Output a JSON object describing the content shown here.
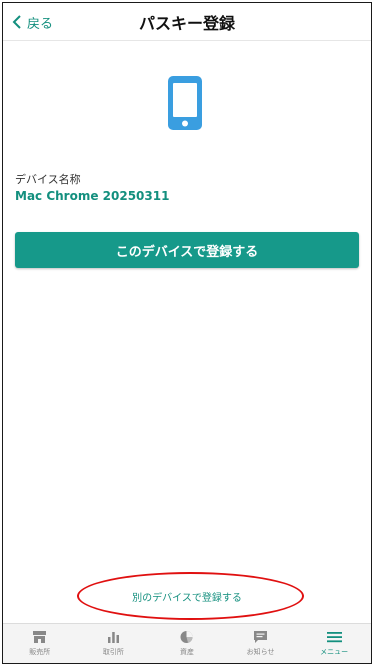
{
  "header": {
    "back_label": "戻る",
    "title": "パスキー登録"
  },
  "device": {
    "label": "デバイス名称",
    "name": "Mac Chrome 20250311"
  },
  "actions": {
    "register_this_device": "このデバイスで登録する",
    "register_other_device": "別のデバイスで登録する"
  },
  "tabbar": {
    "items": [
      {
        "label": "販売所",
        "icon": "shop-icon"
      },
      {
        "label": "取引所",
        "icon": "bar-chart-icon"
      },
      {
        "label": "資産",
        "icon": "pie-chart-icon"
      },
      {
        "label": "お知らせ",
        "icon": "message-icon"
      },
      {
        "label": "メニュー",
        "icon": "menu-icon",
        "active": true
      }
    ]
  },
  "colors": {
    "accent": "#16998a",
    "accent_text": "#138f7e",
    "device_icon": "#3a9ee0",
    "annotation": "#e01010"
  }
}
